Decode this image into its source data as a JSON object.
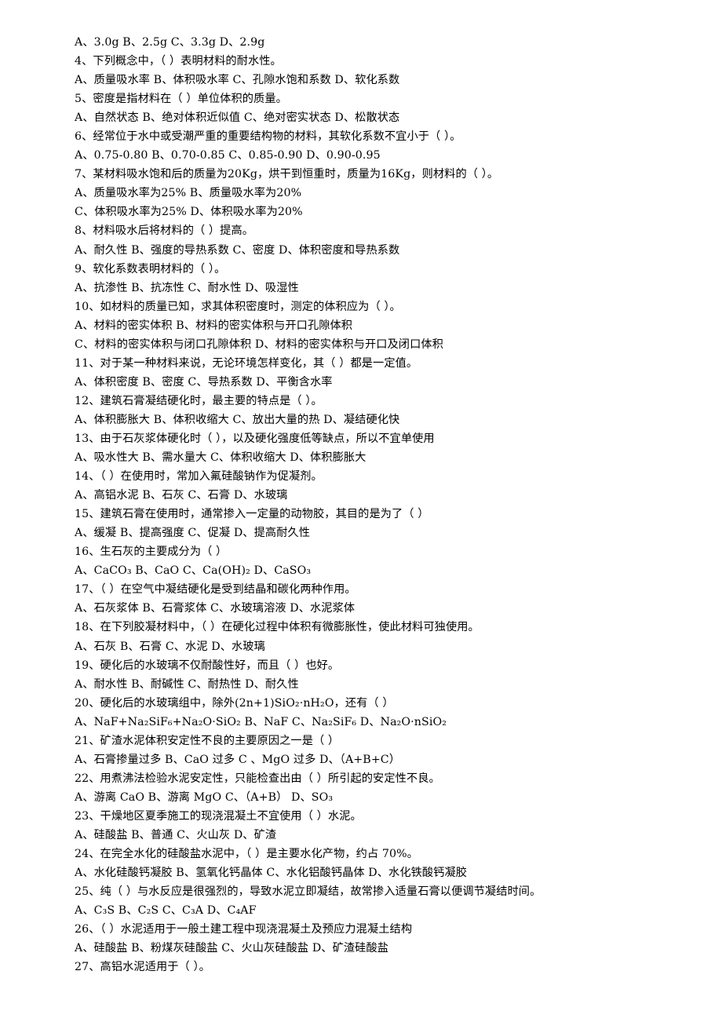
{
  "document": {
    "type": "multiple-choice-exam",
    "language": "zh-CN",
    "background_color": "#ffffff",
    "text_color": "#000000",
    "lines": [
      "A、3.0g        B、2.5g      C、3.3g        D、2.9g",
      "4、下列概念中，（        ）表明材料的耐水性。",
      "A、质量吸水率    B、体积吸水率       C、孔隙水饱和系数     D、软化系数",
      "5、密度是指材料在（        ）单位体积的质量。",
      "A、自然状态     B、绝对体积近似值     C、绝对密实状态    D、松散状态",
      "6、经常位于水中或受潮严重的重要结构物的材料，其软化系数不宜小于（       ）。",
      "A、0.75-0.80      B、0.70-0.85        C、0.85-0.90      D、0.90-0.95",
      "7、某材料吸水饱和后的质量为20Kg，烘干到恒重时，质量为16Kg，则材料的（       ）。",
      "A、质量吸水率为25%                    B、质量吸水率为20%",
      "C、体积吸水率为25%                    D、体积吸水率为20%",
      "8、材料吸水后将材料的（    ）提高。",
      "A、耐久性        B、强度的导热系数    C、密度      D、体积密度和导热系数",
      "9、软化系数表明材料的（      ）。",
      "A、抗渗性      B、抗冻性     C、耐水性       D、吸湿性",
      "10、如材料的质量已知，求其体积密度时，测定的体积应为（        ）。",
      "A、材料的密实体积         B、材料的密实体积与开口孔隙体积",
      "C、材料的密实体积与闭口孔隙体积      D、材料的密实体积与开口及闭口体积",
      "11、对于某一种材料来说，无论环境怎样变化，其（    ）都是一定值。",
      "A、体积密度     B、密度      C、导热系数       D、平衡含水率",
      "12、建筑石膏凝结硬化时，最主要的特点是（        ）。",
      "A、体积膨胀大     B、体积收缩大     C、放出大量的热     D、凝结硬化快",
      "13、由于石灰浆体硬化时（       ），以及硬化强度低等缺点，所以不宜单使用",
      "A、吸水性大     B、需水量大     C、体积收缩大     D、体积膨胀大",
      "14、（     ）在使用时，常加入氟硅酸钠作为促凝剂。",
      "A、高铝水泥    B、石灰    C、石膏    D、水玻璃",
      "15、建筑石膏在使用时，通常掺入一定量的动物胶，其目的是为了（     ）",
      "A、缓凝      B、提高强度    C、促凝    D、提高耐久性",
      "16、生石灰的主要成分为（       ）",
      "A、CaCO₃         B、CaO      C、Ca(OH)₂       D、CaSO₃",
      "17、（      ）在空气中凝结硬化是受到结晶和碳化两种作用。",
      "A、石灰浆体     B、石膏浆体    C、水玻璃溶液    D、水泥浆体",
      "18、在下列胶凝材料中，（      ）在硬化过程中体积有微膨胀性，使此材料可独使用。",
      "A、石灰     B、石膏     C、水泥     D、水玻璃",
      "19、硬化后的水玻璃不仅耐酸性好，而且（      ）也好。",
      "A、耐水性    B、耐碱性    C、耐热性     D、耐久性",
      "20、硬化后的水玻璃组中，除外(2n+1)SiO₂·nH₂O，还有（      ）",
      "A、NaF+Na₂SiF₆+Na₂O·SiO₂    B、NaF    C、Na₂SiF₆    D、Na₂O·nSiO₂",
      "21、矿渣水泥体积安定性不良的主要原因之一是（     ）",
      "A、石膏掺量过多    B、CaO 过多     C 、MgO 过多      D、（A+B+C）",
      "22、用煮沸法检验水泥安定性，只能检查出由（      ）所引起的安定性不良。",
      "A、游离 CaO       B、游离 MgO     C、（A+B）  D、SO₃",
      "23、干燥地区夏季施工的现浇混凝土不宜使用（     ）水泥。",
      "A、硅酸盐      B、普通     C、火山灰    D、矿渣",
      "24、在完全水化的硅酸盐水泥中，（     ）是主要水化产物，约占 70%。",
      "A、水化硅酸钙凝胶 B、氢氧化钙晶体 C、水化铝酸钙晶体 D、水化铁酸钙凝胶",
      "25、纯（     ）与水反应是很强烈的，导致水泥立即凝结，故常掺入适量石膏以便调节凝结时间。",
      "A、C₃S     B、C₂S     C、C₃A     D、C₄AF",
      "26、（     ）水泥适用于一般土建工程中现浇混凝土及预应力混凝土结构",
      "A、硅酸盐      B、粉煤灰硅酸盐   C、火山灰硅酸盐   D、矿渣硅酸盐",
      "27、高铝水泥适用于（      ）。"
    ]
  }
}
